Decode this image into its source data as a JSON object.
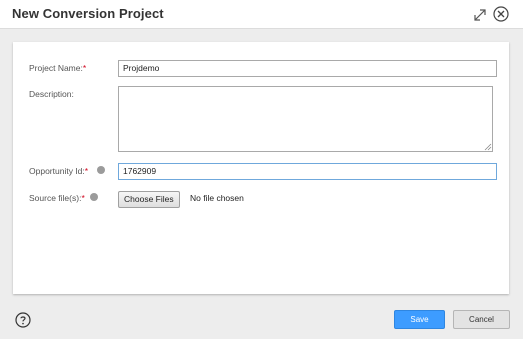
{
  "dialog": {
    "title": "New Conversion Project"
  },
  "form": {
    "project_name": {
      "label": "Project Name:",
      "required_mark": "*",
      "value": "Projdemo"
    },
    "description": {
      "label": "Description:",
      "value": ""
    },
    "opportunity_id": {
      "label": "Opportunity Id:",
      "required_mark": "*",
      "value": "1762909"
    },
    "source_files": {
      "label": "Source file(s):",
      "required_mark": "*",
      "button_label": "Choose Files",
      "status_text": "No file chosen"
    }
  },
  "footer": {
    "save_label": "Save",
    "cancel_label": "Cancel"
  },
  "icons": {
    "expand": "expand-icon",
    "close": "close-icon",
    "info": "info-icon",
    "help": "help-icon"
  },
  "colors": {
    "primary_button": "#3d9cff",
    "required": "#d0021b",
    "focus_border": "#6fa8dc"
  }
}
